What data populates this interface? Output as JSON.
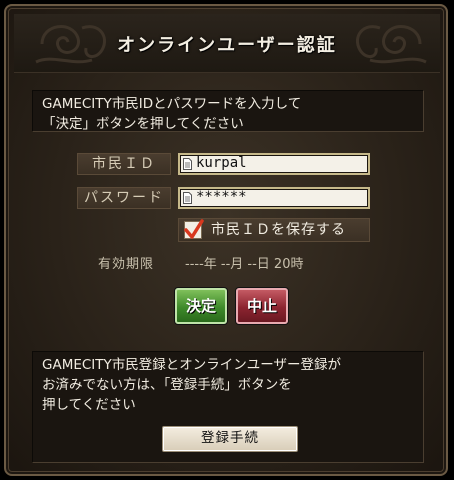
{
  "dialog": {
    "title": "オンラインユーザー認証"
  },
  "intro": {
    "line1": "GAMECITY市民IDとパスワードを入力して",
    "line2": "「決定」ボタンを押してください"
  },
  "form": {
    "citizen_id_label": "市民ＩＤ",
    "citizen_id_value": "kurpal",
    "password_label": "パスワード",
    "password_value": "******",
    "save_id_label": "市民ＩＤを保存する",
    "save_id_checked": true,
    "expiry_label": "有効期限",
    "expiry_value": "----年 --月 --日 20時"
  },
  "buttons": {
    "ok": "決定",
    "cancel": "中止",
    "register": "登録手続"
  },
  "register_info": {
    "line1": "GAMECITY市民登録とオンラインユーザー登録が",
    "line2": "お済みでない方は、「登録手続」ボタンを",
    "line3": "押してください"
  },
  "icons": {
    "field_icon": "document-icon",
    "check": "checkmark-icon"
  },
  "colors": {
    "ok_button": "#3e8a2a",
    "cancel_button": "#8c2430",
    "checkmark": "#d8381e"
  }
}
